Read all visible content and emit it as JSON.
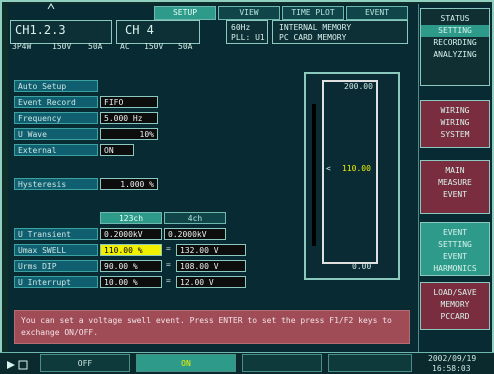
{
  "header": {
    "channel_1_2_3": "CH1.2.3",
    "channel_4": "CH 4",
    "ch123_ranges": [
      "3P4W",
      "150V",
      "50A"
    ],
    "ch4_ranges": [
      "AC",
      "150V",
      "50A"
    ],
    "frequency": "60Hz",
    "pll": "PLL: U1",
    "memory_internal": "INTERNAL MEMORY",
    "memory_pc": "PC CARD MEMORY",
    "tabs": [
      "SETUP",
      "VIEW",
      "TIME PLOT",
      "EVENT"
    ]
  },
  "settings": {
    "auto_setup_label": "Auto Setup",
    "event_record_label": "Event Record",
    "event_record_value": "FIFO",
    "frequency_label": "Frequency",
    "frequency_value": "5.000 Hz",
    "u_wave_label": "U Wave",
    "u_wave_value": "10%",
    "external_label": "External",
    "external_value": "ON",
    "hysteresis_label": "Hysteresis",
    "hysteresis_value": "1.000 %"
  },
  "thresholds": {
    "col_header_1": "123ch",
    "col_header_2": "4ch",
    "rows": [
      {
        "label": "U Transient",
        "v1": "0.2000kV",
        "v2": "0.2000kV"
      },
      {
        "label": "Umax SWELL",
        "v1": "110.00 %",
        "v2": "132.00 V"
      },
      {
        "label": "Urms DIP",
        "v1": "90.00 %",
        "v2": "108.00 V"
      },
      {
        "label": "U Interrupt",
        "v1": "10.00 %",
        "v2": "12.00 V"
      }
    ]
  },
  "meter": {
    "top_value": "200.00",
    "mid_value": "110.00",
    "bottom_value": "0.00"
  },
  "message": "You can set a voltage swell event. Press ENTER to set the press F1/F2 keys to exchange ON/OFF.",
  "sidebar": {
    "status": "STATUS",
    "status_items": [
      "SETTING",
      "RECORDING",
      "ANALYZING"
    ],
    "wiring": "WIRING",
    "wiring_items": [
      "WIRING",
      "SYSTEM"
    ],
    "main": "MAIN",
    "main_items": [
      "MEASURE",
      "EVENT"
    ],
    "event": "EVENT",
    "event_items": [
      "SETTING",
      "EVENT",
      "HARMONICS"
    ],
    "load_save": "LOAD/SAVE",
    "load_save_items": [
      "MEMORY",
      "PCCARD"
    ]
  },
  "footer": {
    "soft_key_1": "OFF",
    "soft_key_2": "ON",
    "date": "2002/09/19",
    "time": "16:58:03"
  },
  "colors": {
    "accent": "#2e9b8a",
    "highlight": "#f0f000",
    "message_bg": "#a04c57"
  }
}
